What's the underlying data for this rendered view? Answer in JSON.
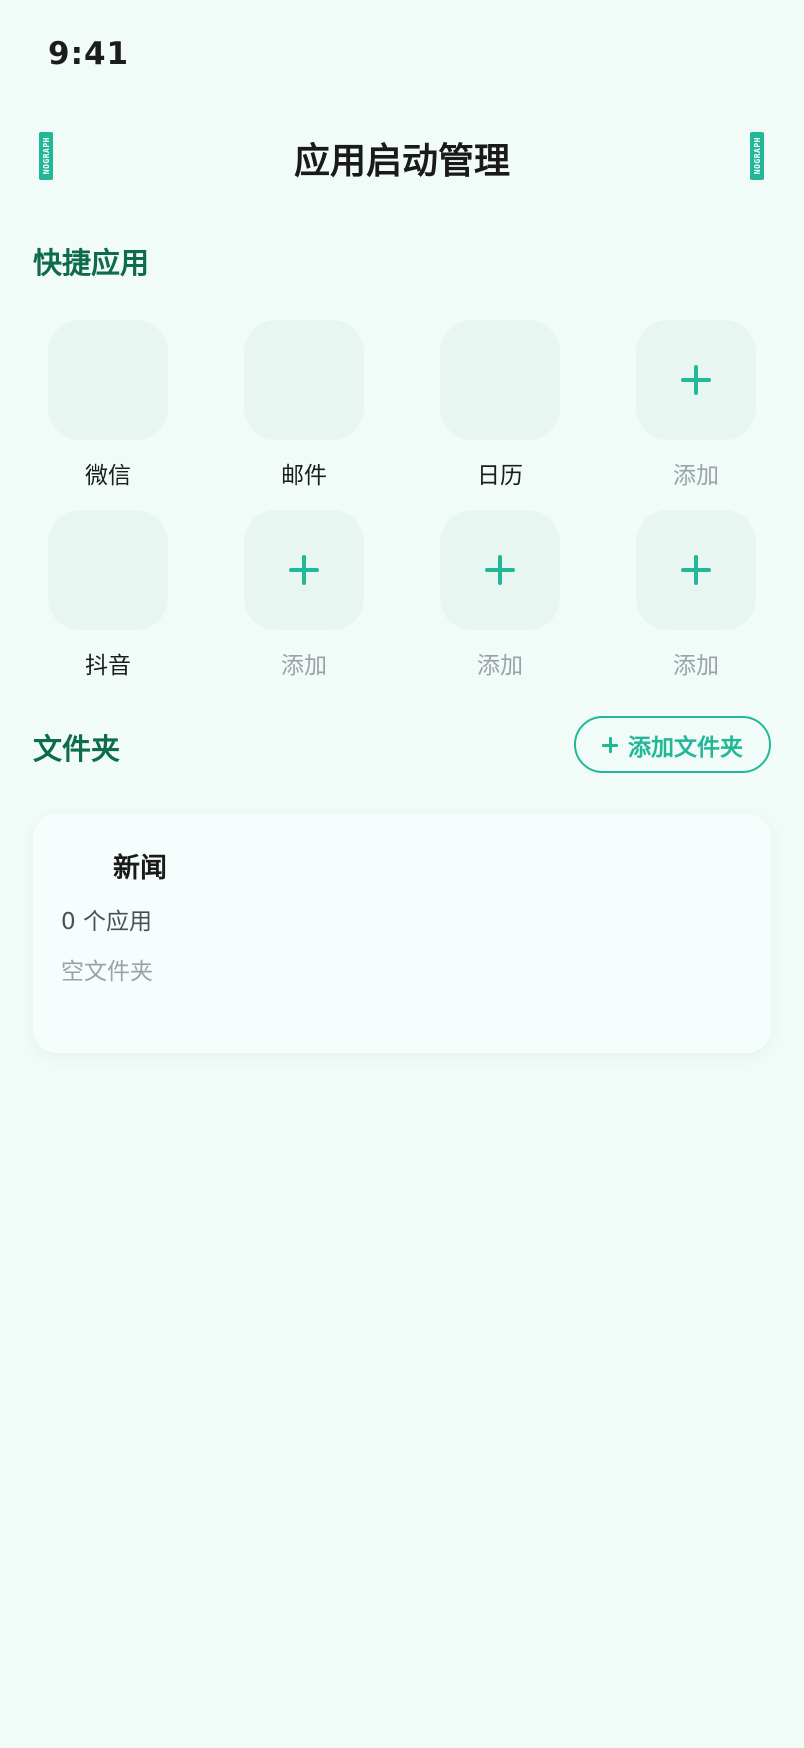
{
  "status_bar": {
    "time": "9:41"
  },
  "header": {
    "title": "应用启动管理",
    "left_icon": "nograph-icon",
    "right_icon": "nograph-icon",
    "icon_text": "NOGRAPH"
  },
  "quick_apps": {
    "title": "快捷应用",
    "items": [
      {
        "label": "微信",
        "type": "app"
      },
      {
        "label": "邮件",
        "type": "app"
      },
      {
        "label": "日历",
        "type": "app"
      },
      {
        "label": "添加",
        "type": "add"
      },
      {
        "label": "抖音",
        "type": "app"
      },
      {
        "label": "添加",
        "type": "add"
      },
      {
        "label": "添加",
        "type": "add"
      },
      {
        "label": "添加",
        "type": "add"
      }
    ]
  },
  "folders": {
    "title": "文件夹",
    "add_button_label": "添加文件夹",
    "items": [
      {
        "name": "新闻",
        "count_text": "0 个应用",
        "empty_text": "空文件夹"
      }
    ]
  },
  "colors": {
    "accent": "#22b897",
    "section_title": "#0e6b4c",
    "background": "#f1fcf9",
    "tile": "#e8f6f2"
  }
}
